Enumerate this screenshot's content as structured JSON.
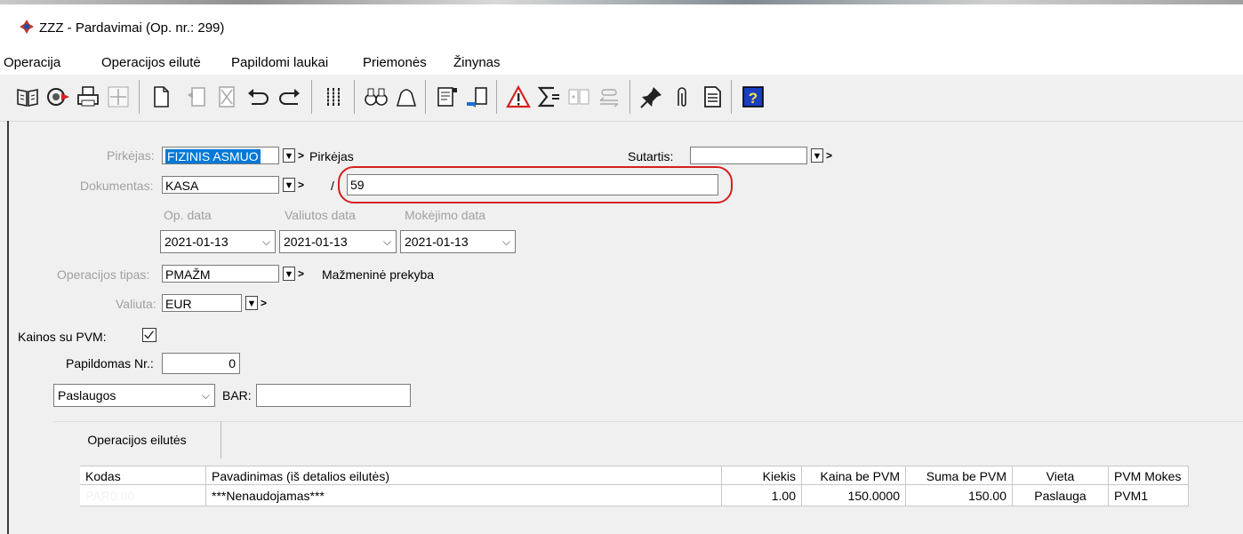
{
  "window": {
    "title": "ZZZ - Pardavimai (Op. nr.: 299)"
  },
  "menu": [
    "Operacija",
    "Operacijos eilutė",
    "Papildomi laukai",
    "Priemonės",
    "Žinynas"
  ],
  "toolbar_icons": [
    "book-icon",
    "refresh-icon",
    "print-icon",
    "move-icon",
    "new-page-icon",
    "undo-doc-icon",
    "delete-icon",
    "undo-icon",
    "redo-icon",
    "columns-icon",
    "binoculars-icon",
    "bag-icon",
    "report-icon",
    "export-icon",
    "warning-icon",
    "sum-icon",
    "split-icon",
    "link-icon",
    "pin-icon",
    "attachment-icon",
    "document-icon",
    "help-icon"
  ],
  "form": {
    "pirkejas_label": "Pirkėjas:",
    "pirkejas_value": "FIZINIS ASMUO",
    "pirkejas_desc": "Pirkėjas",
    "sutartis_label": "Sutartis:",
    "sutartis_value": "",
    "dokumentas_label": "Dokumentas:",
    "dokumentas_value": "KASA",
    "doc_separator": "/",
    "doc_number": "59",
    "op_data_label": "Op. data",
    "valiutos_data_label": "Valiutos data",
    "mokejimo_data_label": "Mokėjimo data",
    "op_data": "2021-01-13",
    "valiutos_data": "2021-01-13",
    "mokejimo_data": "2021-01-13",
    "op_tipas_label": "Operacijos tipas:",
    "op_tipas_value": "PMAŽM",
    "op_tipas_desc": "Mažmeninė prekyba",
    "valiuta_label": "Valiuta:",
    "valiuta_value": "EUR",
    "kainos_pvm_label": "Kainos su PVM:",
    "kainos_pvm_checked": true,
    "papildomas_label": "Papildomas Nr.:",
    "papildomas_value": "0",
    "category_value": "Paslaugos",
    "bar_label": "BAR:",
    "bar_value": ""
  },
  "tabs": [
    "Operacijos eilutės"
  ],
  "table": {
    "columns": [
      "Kodas",
      "Pavadinimas (iš detalios eilutės)",
      "Kiekis",
      "Kaina be PVM",
      "Suma be PVM",
      "Vieta",
      "PVM Mokes"
    ],
    "rows": [
      [
        "PAR0.00",
        "***Nenaudojamas***",
        "1.00",
        "150.0000",
        "150.00",
        "Paslauga",
        "PVM1"
      ]
    ]
  }
}
